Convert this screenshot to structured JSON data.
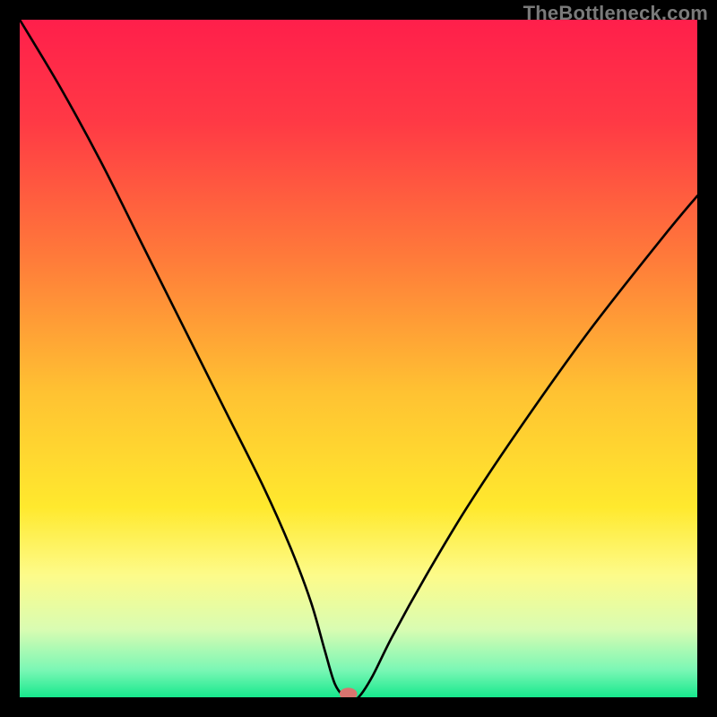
{
  "watermark": "TheBottleneck.com",
  "chart_data": {
    "type": "line",
    "title": "",
    "xlabel": "",
    "ylabel": "",
    "xlim": [
      0,
      100
    ],
    "ylim": [
      0,
      100
    ],
    "grid": false,
    "legend": false,
    "series": [
      {
        "name": "bottleneck-curve",
        "x": [
          0,
          6,
          12,
          18,
          24,
          30,
          36,
          40,
          43,
          45,
          46.5,
          48,
          49,
          50,
          52,
          55,
          60,
          66,
          74,
          84,
          95,
          100
        ],
        "values": [
          100,
          90,
          79,
          67,
          55,
          43,
          31,
          22,
          14,
          7,
          2,
          0,
          0,
          0,
          3,
          9,
          18,
          28,
          40,
          54,
          68,
          74
        ]
      }
    ],
    "gradient_stops": [
      {
        "offset": 0.0,
        "color": "#ff1f4b"
      },
      {
        "offset": 0.15,
        "color": "#ff3945"
      },
      {
        "offset": 0.35,
        "color": "#ff7a3a"
      },
      {
        "offset": 0.55,
        "color": "#ffc232"
      },
      {
        "offset": 0.72,
        "color": "#ffe92e"
      },
      {
        "offset": 0.82,
        "color": "#fdfb8a"
      },
      {
        "offset": 0.9,
        "color": "#d9fcb2"
      },
      {
        "offset": 0.96,
        "color": "#7af7b5"
      },
      {
        "offset": 1.0,
        "color": "#17e88d"
      }
    ],
    "marker": {
      "x": 48.5,
      "y": 0.5,
      "rx": 1.3,
      "ry": 0.9,
      "color": "#d9746f"
    }
  }
}
